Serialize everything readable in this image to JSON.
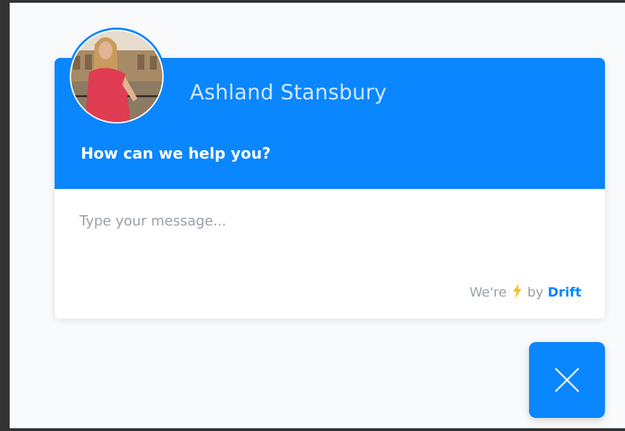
{
  "widget": {
    "agent_name": "Ashland Stansbury",
    "greeting": "How can we help you?",
    "input_placeholder": "Type your message...",
    "footer": {
      "prefix": "We're",
      "middle": "by",
      "brand": "Drift"
    },
    "icons": {
      "close": "close-icon",
      "bolt": "lightning-bolt-icon",
      "avatar": "agent-avatar"
    },
    "colors": {
      "accent": "#0a86ff",
      "bolt": "#f7c21a",
      "placeholder": "#9aa1a8"
    }
  }
}
